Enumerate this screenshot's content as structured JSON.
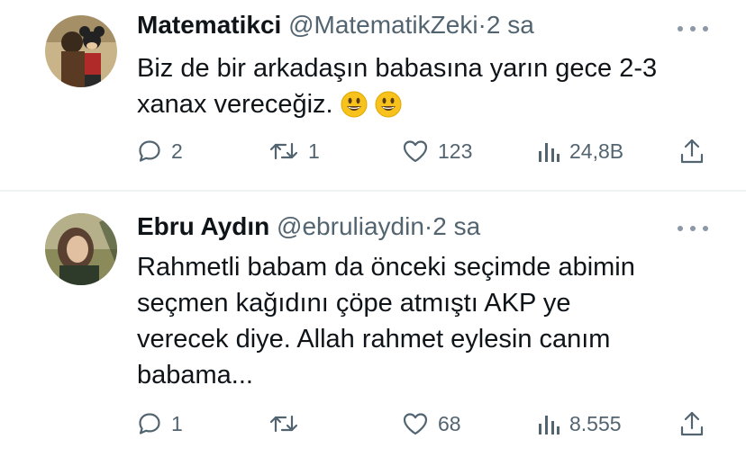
{
  "tweets": [
    {
      "name": "Matematikci",
      "handle": "@MatematikZeki",
      "separator": "·",
      "time": "2 sa",
      "text": "Biz de bir arkadaşın babasına yarın gece 2-3 xanax vereceğiz.",
      "emojis": [
        "grinning-face-emoji",
        "grinning-face-emoji"
      ],
      "replies": "2",
      "retweets": "1",
      "likes": "123",
      "views": "24,8B"
    },
    {
      "name": "Ebru Aydın",
      "handle": "@ebruliaydin",
      "separator": "·",
      "time": "2 sa",
      "text_lines": [
        "Rahmetli babam da önceki seçimde abimin",
        "seçmen kağıdını çöpe atmıştı AKP ye",
        "verecek diye. Allah rahmet eylesin canım",
        "babama..."
      ],
      "replies": "1",
      "retweets": "",
      "likes": "68",
      "views": "8.555"
    }
  ],
  "colors": {
    "text": "#0f1419",
    "secondary": "#536471",
    "divider": "#eff3f4",
    "emoji": "#f7c21c"
  }
}
